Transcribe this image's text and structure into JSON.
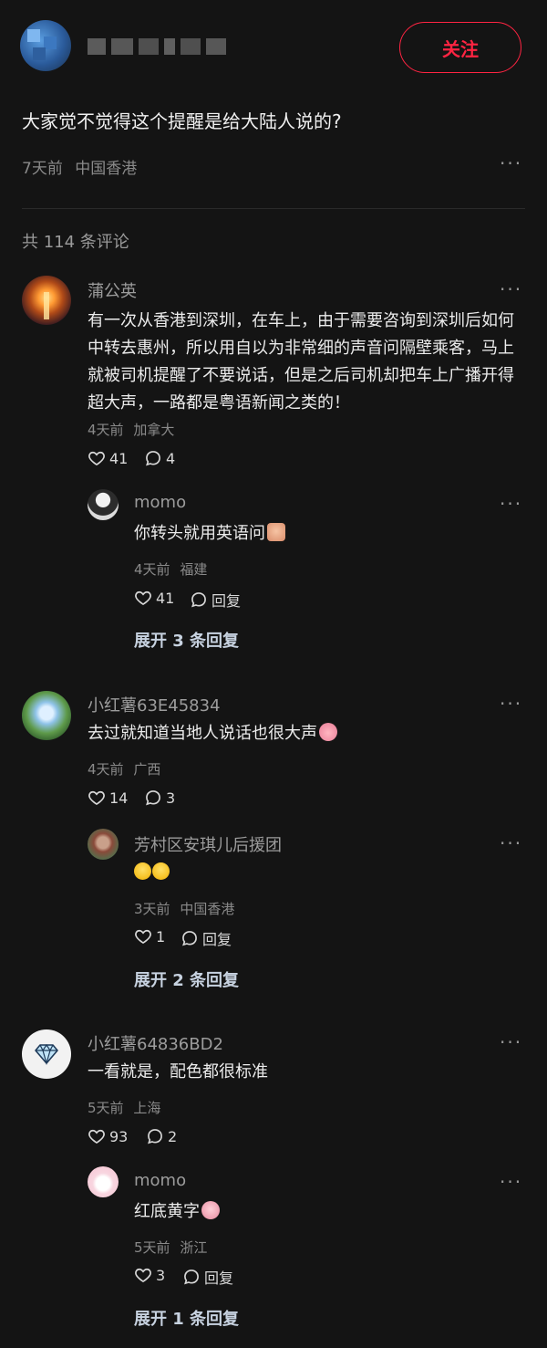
{
  "header": {
    "follow_label": "关注"
  },
  "post": {
    "title": "大家觉不觉得这个提醒是给大陆人说的?",
    "time": "7天前",
    "location": "中国香港"
  },
  "comments_count_label": "共 114 条评论",
  "comments": [
    {
      "name": "蒲公英",
      "text": "有一次从香港到深圳，在车上，由于需要咨询到深圳后如何中转去惠州，所以用自以为非常细的声音问隔壁乘客，马上就被司机提醒了不要说话，但是之后司机却把车上广播开得超大声，一路都是粤语新闻之类的！",
      "time": "4天前",
      "location": "加拿大",
      "likes": "41",
      "replies": "4",
      "reply": {
        "name": "momo",
        "text": "你转头就用英语问",
        "time": "4天前",
        "location": "福建",
        "likes": "41",
        "reply_label": "回复"
      },
      "expand_label": "展开 3 条回复"
    },
    {
      "name": "小红薯63E45834",
      "text": "去过就知道当地人说话也很大声",
      "time": "4天前",
      "location": "广西",
      "likes": "14",
      "replies": "3",
      "reply": {
        "name": "芳村区安琪儿后援团",
        "text": "",
        "time": "3天前",
        "location": "中国香港",
        "likes": "1",
        "reply_label": "回复"
      },
      "expand_label": "展开 2 条回复"
    },
    {
      "name": "小红薯64836BD2",
      "text": "一看就是，配色都很标准",
      "time": "5天前",
      "location": "上海",
      "likes": "93",
      "replies": "2",
      "reply": {
        "name": "momo",
        "text": "红底黄字",
        "time": "5天前",
        "location": "浙江",
        "likes": "3",
        "reply_label": "回复"
      },
      "expand_label": "展开 1 条回复"
    }
  ],
  "colors": {
    "background": "#141414",
    "follow_accent": "#ff2442",
    "expand_text": "#c7d2e0"
  },
  "icons": [
    "heart-icon",
    "comment-icon",
    "more-icon",
    "emoji-icon",
    "diamond-icon"
  ]
}
